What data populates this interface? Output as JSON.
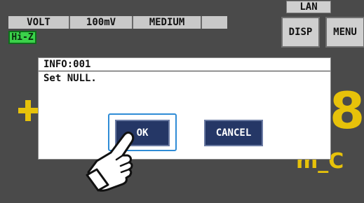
{
  "status_bar": {
    "interface_tab": "LAN",
    "function": "VOLT",
    "range": "100mV",
    "speed": "MEDIUM",
    "input_impedance": "Hi-Z"
  },
  "side_buttons": {
    "disp_label": "DISP",
    "menu_label": "MENU"
  },
  "background_display": {
    "digit": "8",
    "unit": "m_C"
  },
  "dialog": {
    "title": "INFO:001",
    "message": "Set NULL.",
    "ok_label": "OK",
    "cancel_label": "CANCEL",
    "focused_button": "OK"
  },
  "colors": {
    "screen_bg": "#4a4a4a",
    "measurement_yellow": "#e7c20a",
    "hiz_green": "#3bd24a",
    "button_navy": "#253766",
    "focus_blue": "#2f8cd6"
  },
  "icons": {
    "pointer": "pointing-hand-icon"
  }
}
